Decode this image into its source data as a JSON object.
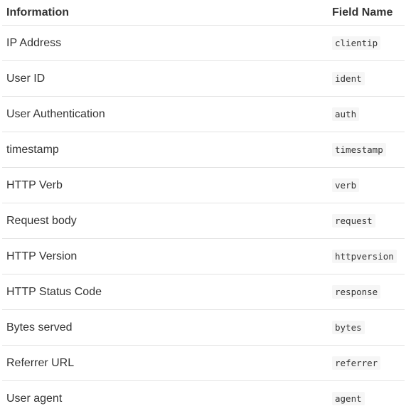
{
  "table": {
    "headers": [
      "Information",
      "Field Name"
    ],
    "rows": [
      {
        "info": "IP Address",
        "field": "clientip"
      },
      {
        "info": "User ID",
        "field": "ident"
      },
      {
        "info": "User Authentication",
        "field": "auth"
      },
      {
        "info": "timestamp",
        "field": "timestamp"
      },
      {
        "info": "HTTP Verb",
        "field": "verb"
      },
      {
        "info": "Request body",
        "field": "request"
      },
      {
        "info": "HTTP Version",
        "field": "httpversion"
      },
      {
        "info": "HTTP Status Code",
        "field": "response"
      },
      {
        "info": "Bytes served",
        "field": "bytes"
      },
      {
        "info": "Referrer URL",
        "field": "referrer"
      },
      {
        "info": "User agent",
        "field": "agent"
      }
    ]
  }
}
